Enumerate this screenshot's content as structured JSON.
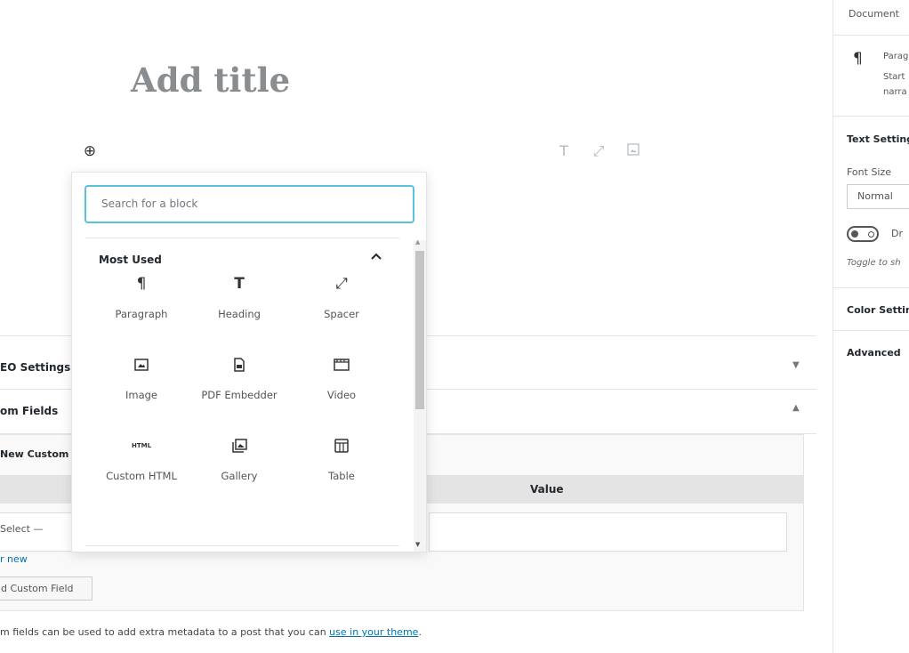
{
  "editor": {
    "title_placeholder": "Add title",
    "inserter_icon": "plus-circle-icon",
    "toolbar_icons": [
      "heading-icon",
      "spacer-icon",
      "image-icon"
    ]
  },
  "meta_boxes": {
    "seo_settings": "EO Settings",
    "custom_fields": "om Fields",
    "add_new_custom": "New Custom F",
    "value_header": "Value",
    "select_placeholder": "Select —",
    "enter_new": "r new",
    "add_button": "d Custom Field",
    "help_prefix": "m fields can be used to add extra metadata to a post that you can ",
    "help_link": "use in your theme",
    "help_suffix": "."
  },
  "sidebar": {
    "tab": "Document",
    "block_name": "Parag",
    "block_desc_1": "Start",
    "block_desc_2": "narra",
    "text_settings": "Text Setting",
    "font_size_label": "Font Size",
    "font_size_value": "Normal",
    "dropcap_label": "Dr",
    "toggle_help": "Toggle to sh",
    "color_settings": "Color Settin",
    "advanced": "Advanced"
  },
  "inserter": {
    "search_placeholder": "Search for a block",
    "panel_title": "Most Used",
    "blocks": [
      {
        "label": "Paragraph",
        "icon": "paragraph-icon"
      },
      {
        "label": "Heading",
        "icon": "heading-icon"
      },
      {
        "label": "Spacer",
        "icon": "spacer-icon"
      },
      {
        "label": "Image",
        "icon": "image-icon"
      },
      {
        "label": "PDF Embedder",
        "icon": "pdf-file-icon"
      },
      {
        "label": "Video",
        "icon": "video-icon"
      },
      {
        "label": "Custom HTML",
        "icon": "html-icon"
      },
      {
        "label": "Gallery",
        "icon": "gallery-icon"
      },
      {
        "label": "Table",
        "icon": "table-icon"
      }
    ]
  },
  "colors": {
    "accent": "#5ac2dc",
    "link": "#0073aa"
  }
}
